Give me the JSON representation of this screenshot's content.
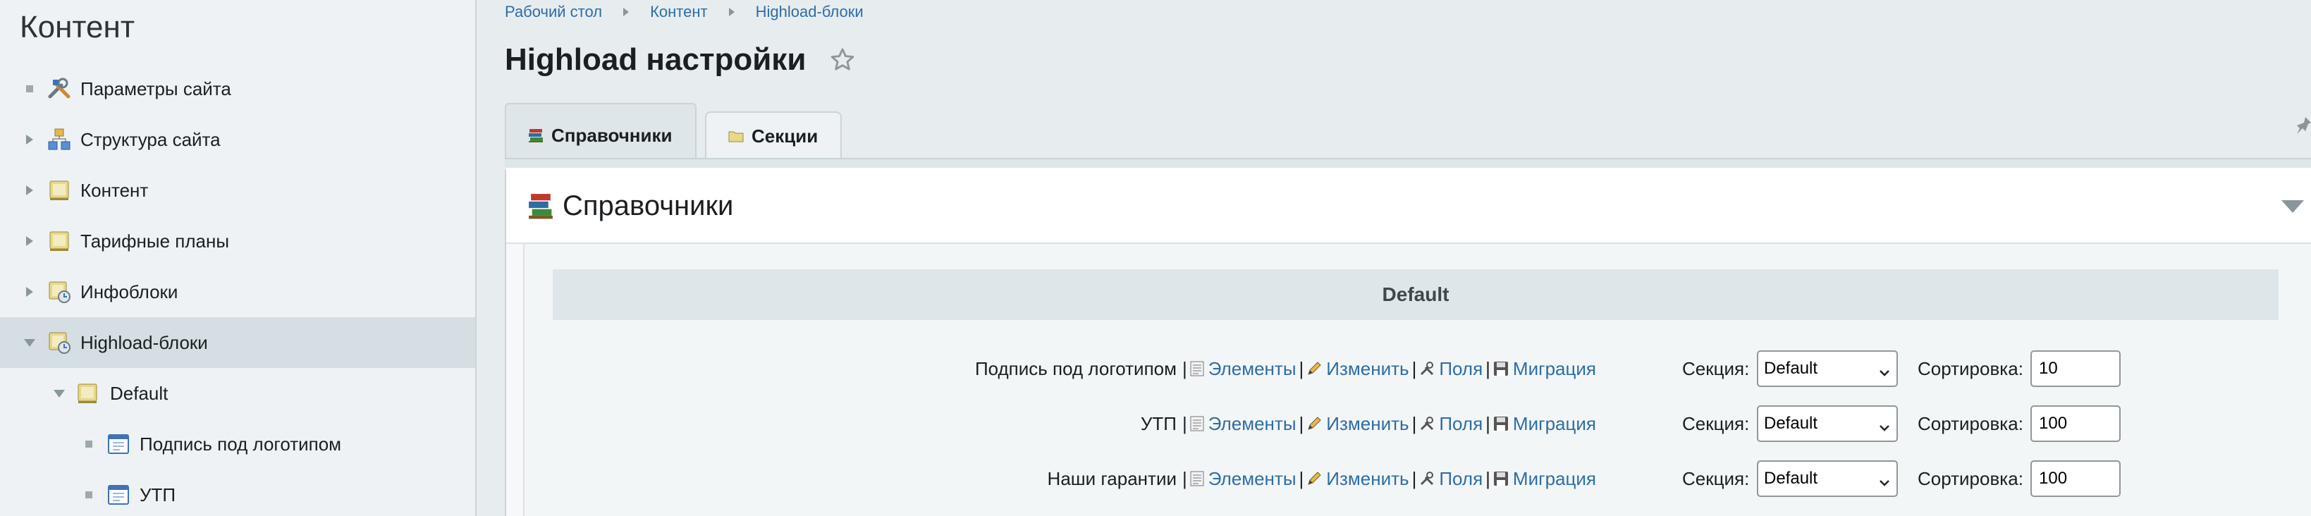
{
  "sidebar": {
    "title": "Контент",
    "items": [
      {
        "label": "Параметры сайта",
        "icon": "tools-icon",
        "marker": "square"
      },
      {
        "label": "Структура сайта",
        "icon": "site-structure-icon",
        "marker": "arrow-right"
      },
      {
        "label": "Контент",
        "icon": "content-icon",
        "marker": "arrow-right"
      },
      {
        "label": "Тарифные планы",
        "icon": "content-icon",
        "marker": "arrow-right"
      },
      {
        "label": "Инфоблоки",
        "icon": "infoblock-icon",
        "marker": "arrow-right"
      },
      {
        "label": "Highload-блоки",
        "icon": "infoblock-icon",
        "marker": "arrow-down",
        "active": true
      },
      {
        "label": "Default",
        "icon": "content-icon",
        "marker": "arrow-down"
      },
      {
        "label": "Подпись под логотипом",
        "icon": "table-icon",
        "marker": "square"
      },
      {
        "label": "УТП",
        "icon": "table-icon",
        "marker": "square"
      }
    ]
  },
  "breadcrumb": [
    "Рабочий стол",
    "Контент",
    "Highload-блоки"
  ],
  "page_title": "Highload настройки",
  "tabs": [
    {
      "label": "Справочники",
      "active": true
    },
    {
      "label": "Секции",
      "active": false
    }
  ],
  "panel": {
    "title": "Справочники",
    "group": "Default",
    "link_labels": {
      "elements": "Элементы",
      "edit": "Изменить",
      "fields": "Поля",
      "migration": "Миграция"
    },
    "section_label": "Секция:",
    "sort_label": "Сортировка:",
    "rows": [
      {
        "name": "Подпись под логотипом",
        "section": "Default",
        "sort": "10"
      },
      {
        "name": "УТП",
        "section": "Default",
        "sort": "100"
      },
      {
        "name": "Наши гарантии",
        "section": "Default",
        "sort": "100"
      }
    ]
  },
  "colors": {
    "link": "#2e6da4",
    "sidebar_bg": "#eef2f4",
    "active_item_bg": "#d5dee2",
    "header_bg": "#dfe6e9"
  }
}
